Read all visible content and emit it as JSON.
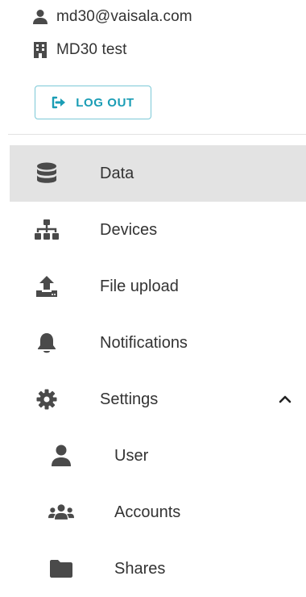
{
  "user": {
    "email": "md30@vaisala.com",
    "organization": "MD30 test",
    "logout_label": "LOG OUT"
  },
  "nav": {
    "items": [
      {
        "label": "Data",
        "icon": "database-icon",
        "active": true
      },
      {
        "label": "Devices",
        "icon": "sitemap-icon"
      },
      {
        "label": "File upload",
        "icon": "upload-icon"
      },
      {
        "label": "Notifications",
        "icon": "bell-icon"
      },
      {
        "label": "Settings",
        "icon": "gear-icon",
        "expanded": true
      }
    ],
    "settings_sub": [
      {
        "label": "User",
        "icon": "user-icon"
      },
      {
        "label": "Accounts",
        "icon": "users-icon"
      },
      {
        "label": "Shares",
        "icon": "folder-icon"
      }
    ]
  },
  "colors": {
    "accent": "#1a9db5",
    "icon": "#4a4a4a",
    "active_bg": "#e3e3e3"
  }
}
